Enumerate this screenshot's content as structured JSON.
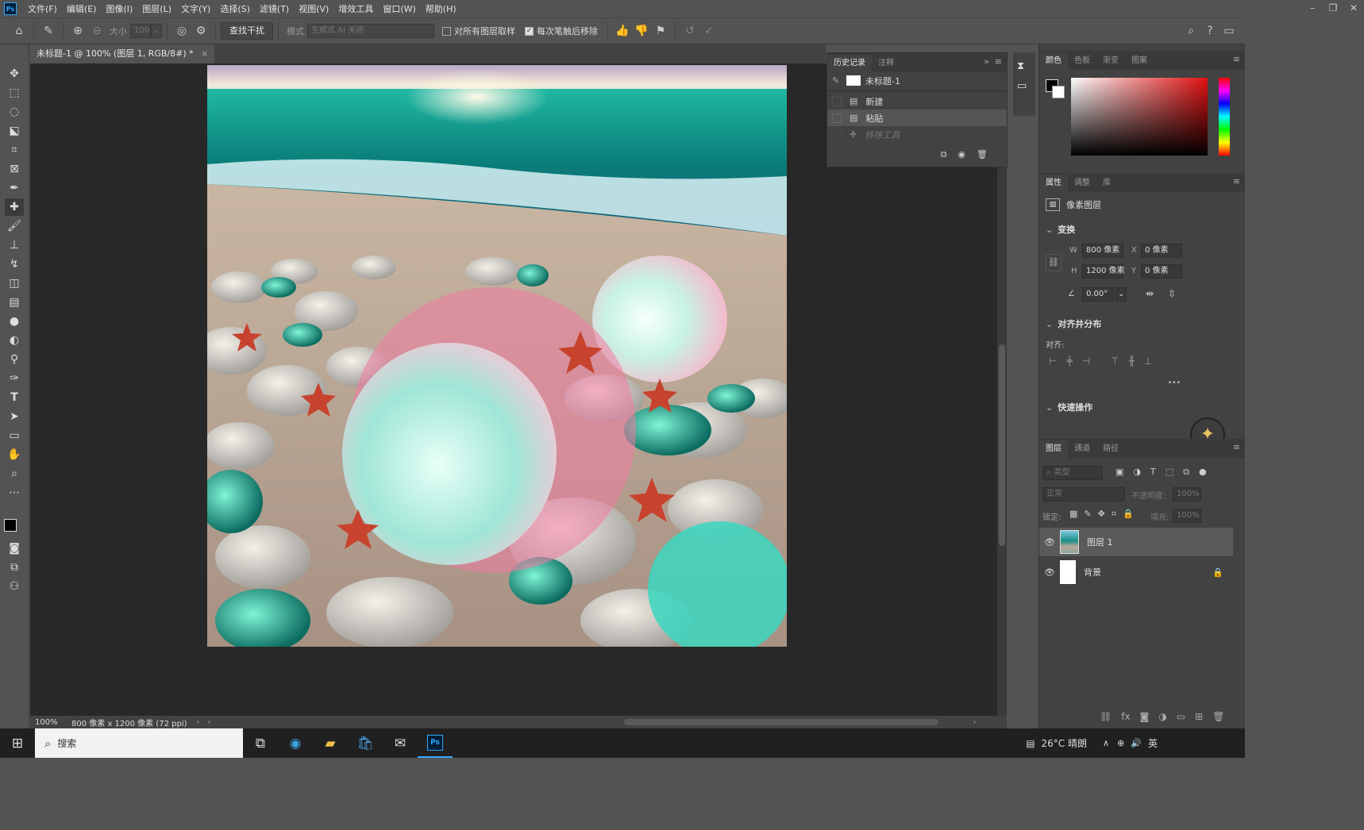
{
  "app": {
    "logo": "Ps"
  },
  "menu": [
    "文件(F)",
    "编辑(E)",
    "图像(I)",
    "图层(L)",
    "文字(Y)",
    "选择(S)",
    "滤镜(T)",
    "视图(V)",
    "增效工具",
    "窗口(W)",
    "帮助(H)"
  ],
  "window_controls": {
    "minimize": "–",
    "restore": "❐",
    "close": "✕"
  },
  "options": {
    "size_label": "大小",
    "size_value": "100",
    "find_distractions": "查找干扰",
    "mode_label": "模式",
    "mode_value": "生成式 AI 关闭",
    "sample_all": "对所有图层取样",
    "remove_after_stroke": "每次笔触后移除"
  },
  "document": {
    "tab_title": "未标题-1 @ 100% (图层 1, RGB/8#) *",
    "zoom": "100%",
    "dimensions": "800 像素 x 1200 像素 (72 ppi)"
  },
  "history": {
    "tabs": [
      "历史记录",
      "注释"
    ],
    "snapshot": "未标题-1",
    "items": [
      "新建",
      "粘贴",
      "移除工具"
    ]
  },
  "color_panel": {
    "tabs": [
      "颜色",
      "色板",
      "渐变",
      "图案"
    ]
  },
  "properties": {
    "tabs": [
      "属性",
      "调整",
      "库"
    ],
    "kind": "像素图层",
    "transform_title": "变换",
    "w_label": "W",
    "w_value": "800 像素",
    "h_label": "H",
    "h_value": "1200 像素",
    "x_label": "X",
    "x_value": "0 像素",
    "y_label": "Y",
    "y_value": "0 像素",
    "angle": "0.00°",
    "align_title": "对齐并分布",
    "align_label": "对齐:",
    "more": "•••",
    "quick_title": "快速操作"
  },
  "layers": {
    "tabs": [
      "图层",
      "通道",
      "路径"
    ],
    "filter_placeholder": "类型",
    "blend_mode": "正常",
    "opacity_label": "不透明度:",
    "opacity_value": "100%",
    "lock_label": "锁定:",
    "fill_label": "填充:",
    "fill_value": "100%",
    "items": [
      {
        "name": "图层 1"
      },
      {
        "name": "背景"
      }
    ]
  },
  "taskbar": {
    "search_placeholder": "搜索",
    "weather": "26°C 晴朗",
    "lang": "英"
  },
  "colors": {
    "accent": "#31a8ff",
    "panel": "#424242",
    "bg": "#535353",
    "canvas": "#282828"
  }
}
